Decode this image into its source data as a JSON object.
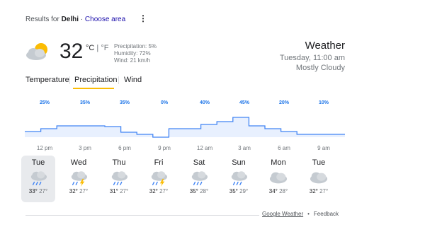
{
  "header": {
    "results_prefix": "Results for",
    "location": "Delhi",
    "separator": " · ",
    "choose_area": "Choose area",
    "more_icon": "more-vert-icon"
  },
  "current": {
    "icon": "partly-cloudy-icon",
    "temperature": "32",
    "unit_c": "°C",
    "unit_sep": " | ",
    "unit_f": "°F",
    "precipitation": "Precipitation: 5%",
    "humidity": "Humidity: 72%",
    "wind": "Wind: 21 km/h"
  },
  "summary": {
    "title": "Weather",
    "datetime": "Tuesday, 11:00 am",
    "condition": "Mostly Cloudy"
  },
  "tabs": [
    {
      "label": "Temperature",
      "active": false
    },
    {
      "label": "Precipitation",
      "active": true
    },
    {
      "label": "Wind",
      "active": false
    }
  ],
  "hourly": {
    "percents": [
      "25%",
      "35%",
      "35%",
      "0%",
      "40%",
      "45%",
      "20%",
      "10%"
    ],
    "times": [
      "12 pm",
      "3 pm",
      "6 pm",
      "9 pm",
      "12 am",
      "3 am",
      "6 am",
      "9 am"
    ],
    "levels": [
      8,
      12,
      16,
      16,
      16,
      15,
      7,
      4,
      0,
      12,
      12,
      18,
      22,
      28,
      16,
      12,
      8,
      4,
      4,
      4
    ],
    "accent": "#1a73e8",
    "fill": "#e8f0fe",
    "line": "#4285f4"
  },
  "days": [
    {
      "name": "Tue",
      "icon": "rain-icon",
      "high": "33°",
      "low": "27°",
      "selected": true
    },
    {
      "name": "Wed",
      "icon": "thunderstorm-icon",
      "high": "32°",
      "low": "27°",
      "selected": false
    },
    {
      "name": "Thu",
      "icon": "rain-icon",
      "high": "31°",
      "low": "27°",
      "selected": false
    },
    {
      "name": "Fri",
      "icon": "thunderstorm-icon",
      "high": "32°",
      "low": "27°",
      "selected": false
    },
    {
      "name": "Sat",
      "icon": "rain-icon",
      "high": "35°",
      "low": "28°",
      "selected": false
    },
    {
      "name": "Sun",
      "icon": "rain-icon",
      "high": "35°",
      "low": "29°",
      "selected": false
    },
    {
      "name": "Mon",
      "icon": "cloudy-icon",
      "high": "34°",
      "low": "28°",
      "selected": false
    },
    {
      "name": "Tue",
      "icon": "cloudy-icon",
      "high": "32°",
      "low": "27°",
      "selected": false
    }
  ],
  "footer": {
    "source": "Google Weather",
    "feedback": "Feedback"
  }
}
